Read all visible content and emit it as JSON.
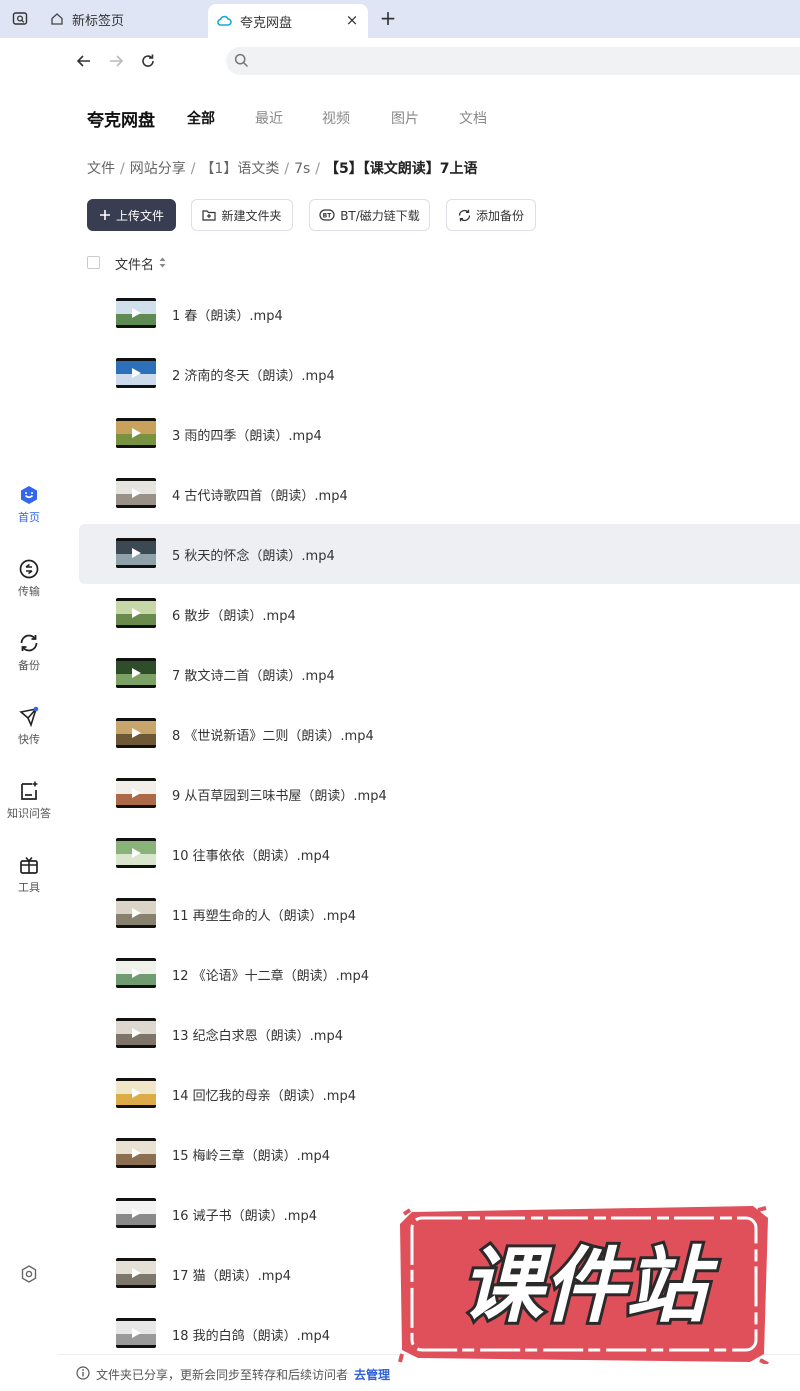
{
  "browser": {
    "tabs": [
      {
        "label": "新标签页",
        "active": false
      },
      {
        "label": "夸克网盘",
        "active": true
      }
    ],
    "new_tab_symbol": "+",
    "close_symbol": "×"
  },
  "app": {
    "brand": "夸克网盘",
    "category_tabs": [
      {
        "label": "全部",
        "active": true
      },
      {
        "label": "最近",
        "active": false
      },
      {
        "label": "视频",
        "active": false
      },
      {
        "label": "图片",
        "active": false
      },
      {
        "label": "文档",
        "active": false
      }
    ]
  },
  "sidebar": {
    "items": [
      {
        "label": "首页",
        "icon": "home-icon",
        "active": true
      },
      {
        "label": "传输",
        "icon": "transfer-icon",
        "active": false
      },
      {
        "label": "备份",
        "icon": "backup-icon",
        "active": false
      },
      {
        "label": "快传",
        "icon": "quick-send-icon",
        "active": false
      },
      {
        "label": "知识问答",
        "icon": "knowledge-qa-icon",
        "active": false
      },
      {
        "label": "工具",
        "icon": "tools-icon",
        "active": false
      }
    ]
  },
  "breadcrumb": [
    "文件",
    "网站分享",
    "【1】语文类",
    "7s",
    "【5】【课文朗读】7上语"
  ],
  "toolbar": {
    "upload": "上传文件",
    "new_folder": "新建文件夹",
    "bt_download": "BT/磁力链下载",
    "add_backup": "添加备份"
  },
  "list_header": {
    "name_column": "文件名"
  },
  "files": [
    {
      "name": "1 春（朗读）.mp4"
    },
    {
      "name": "2 济南的冬天（朗读）.mp4"
    },
    {
      "name": "3 雨的四季（朗读）.mp4"
    },
    {
      "name": "4 古代诗歌四首（朗读）.mp4"
    },
    {
      "name": "5 秋天的怀念（朗读）.mp4"
    },
    {
      "name": "6 散步（朗读）.mp4"
    },
    {
      "name": "7 散文诗二首（朗读）.mp4"
    },
    {
      "name": "8 《世说新语》二则（朗读）.mp4"
    },
    {
      "name": "9 从百草园到三味书屋（朗读）.mp4"
    },
    {
      "name": "10 往事依依（朗读）.mp4"
    },
    {
      "name": "11 再塑生命的人（朗读）.mp4"
    },
    {
      "name": "12 《论语》十二章（朗读）.mp4"
    },
    {
      "name": "13 纪念白求恩（朗读）.mp4"
    },
    {
      "name": "14 回忆我的母亲（朗读）.mp4"
    },
    {
      "name": "15 梅岭三章（朗读）.mp4"
    },
    {
      "name": "16 诫子书（朗读）.mp4"
    },
    {
      "name": "17 猫（朗读）.mp4"
    },
    {
      "name": "18 我的白鸽（朗读）.mp4"
    }
  ],
  "footer": {
    "notice": "文件夹已分享，更新会同步至转存和后续访问者",
    "link": "去管理"
  },
  "watermark": {
    "text": "课件站"
  },
  "colors": {
    "accent": "#3367f0",
    "primary_button": "#383d52",
    "tab_strip": "#dfe5f4",
    "stamp_red": "#e0505a",
    "row_hover": "#eeeff2"
  }
}
